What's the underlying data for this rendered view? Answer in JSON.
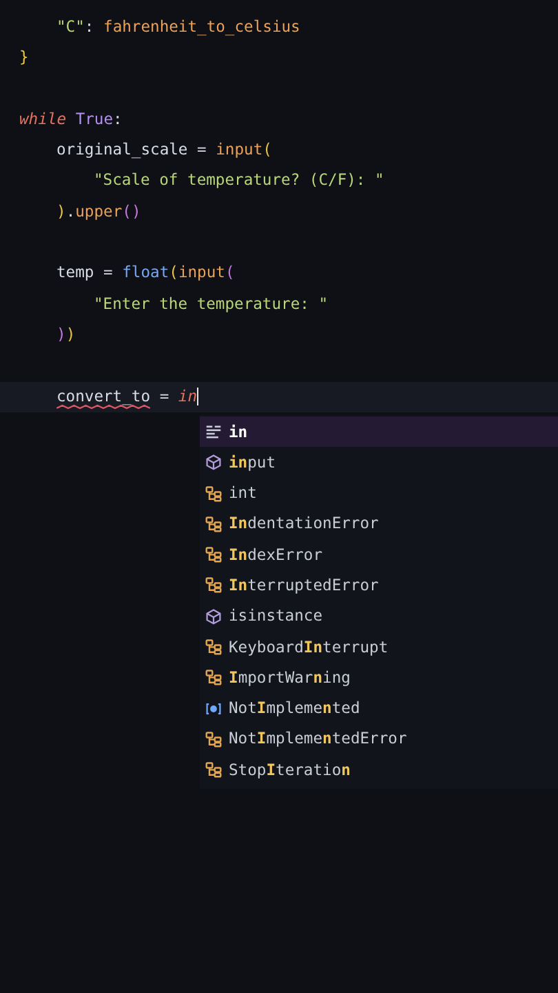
{
  "editor": {
    "lines": [
      {
        "children": [
          {
            "current": false,
            "blank_before": false,
            "tokens": [
              {
                "kind": "string",
                "text": "\"C\""
              },
              {
                "kind": "plain",
                "text": ": "
              },
              {
                "kind": "func",
                "text": "fahrenheit_to_celsius"
              }
            ]
          }
        ]
      },
      {
        "current": false,
        "blank_before": false,
        "tokens": [
          {
            "kind": "bracket",
            "text": "}"
          }
        ]
      },
      {
        "current": false,
        "blank_before": true,
        "tokens": [
          {
            "kind": "keyword",
            "text": "while"
          },
          {
            "kind": "constant",
            "text": " True"
          },
          {
            "kind": "plain",
            "text": ":"
          }
        ],
        "children": [
          {
            "current": false,
            "blank_before": false,
            "tokens": [
              {
                "kind": "plain",
                "text": "original_scale = "
              },
              {
                "kind": "func",
                "text": "input"
              },
              {
                "kind": "bracket",
                "text": "("
              }
            ],
            "children": [
              {
                "current": false,
                "blank_before": false,
                "tokens": [
                  {
                    "kind": "string",
                    "text": "\"Scale of temperature? (C/F): \""
                  }
                ]
              }
            ]
          },
          {
            "current": false,
            "blank_before": false,
            "tokens": [
              {
                "kind": "bracket",
                "text": ")"
              },
              {
                "kind": "plain",
                "text": "."
              },
              {
                "kind": "func",
                "text": "upper"
              },
              {
                "kind": "bracket2",
                "text": "()"
              }
            ]
          },
          {
            "current": false,
            "blank_before": true,
            "tokens": [
              {
                "kind": "plain",
                "text": "temp = "
              },
              {
                "kind": "builtin",
                "text": "float"
              },
              {
                "kind": "bracket",
                "text": "("
              },
              {
                "kind": "func",
                "text": "input"
              },
              {
                "kind": "bracket2",
                "text": "("
              }
            ],
            "children": [
              {
                "current": false,
                "blank_before": false,
                "tokens": [
                  {
                    "kind": "string",
                    "text": "\"Enter the temperature: \""
                  }
                ]
              }
            ]
          },
          {
            "current": false,
            "blank_before": false,
            "tokens": [
              {
                "kind": "bracket2",
                "text": ")"
              },
              {
                "kind": "bracket",
                "text": ")"
              }
            ]
          },
          {
            "current": true,
            "blank_before": true,
            "tokens": [
              {
                "kind": "plain",
                "text": "convert_to",
                "error": true
              },
              {
                "kind": "plain",
                "text": " = "
              },
              {
                "kind": "keyword",
                "text": "in"
              }
            ]
          }
        ]
      }
    ]
  },
  "suggestions": [
    {
      "kind": "keyword",
      "label": "**in**",
      "selected": true
    },
    {
      "kind": "function",
      "label": "**in**put",
      "selected": false
    },
    {
      "kind": "class",
      "label": "int",
      "selected": false
    },
    {
      "kind": "class",
      "label": "**In**dentationError",
      "selected": false
    },
    {
      "kind": "class",
      "label": "**In**dexError",
      "selected": false
    },
    {
      "kind": "class",
      "label": "**In**terruptedError",
      "selected": false
    },
    {
      "kind": "function",
      "label": "isinstance",
      "selected": false
    },
    {
      "kind": "class",
      "label": "Keyboard**In**terrupt",
      "selected": false
    },
    {
      "kind": "class",
      "label": "**I**mportWar**n**ing",
      "selected": false
    },
    {
      "kind": "constant",
      "label": "Not**I**mpleme**n**ted",
      "selected": false
    },
    {
      "kind": "class",
      "label": "Not**I**mpleme**n**tedError",
      "selected": false
    },
    {
      "kind": "class",
      "label": "Stop**I**teratio**n**",
      "selected": false
    }
  ]
}
